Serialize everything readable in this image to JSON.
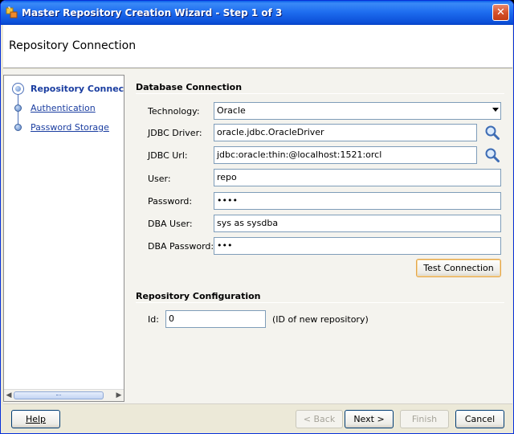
{
  "window": {
    "title": "Master Repository Creation Wizard - Step 1 of 3",
    "close_glyph": "✕"
  },
  "header": {
    "title": "Repository Connection"
  },
  "nav": {
    "items": [
      {
        "label": "Repository Connection",
        "active": true
      },
      {
        "label": "Authentication",
        "active": false
      },
      {
        "label": "Password Storage",
        "active": false
      }
    ]
  },
  "database_connection": {
    "section_title": "Database Connection",
    "technology_label": "Technology:",
    "technology_value": "Oracle",
    "jdbc_driver_label": "JDBC Driver:",
    "jdbc_driver_value": "oracle.jdbc.OracleDriver",
    "jdbc_url_label": "JDBC Url:",
    "jdbc_url_value": "jdbc:oracle:thin:@localhost:1521:orcl",
    "user_label": "User:",
    "user_value": "repo",
    "password_label": "Password:",
    "password_value": "••••",
    "dba_user_label": "DBA User:",
    "dba_user_value": "sys as sysdba",
    "dba_password_label": "DBA Password:",
    "dba_password_value": "•••",
    "test_connection_label": "Test Connection"
  },
  "repository_configuration": {
    "section_title": "Repository Configuration",
    "id_label": "Id:",
    "id_value": "0",
    "id_note": "(ID of new repository)"
  },
  "footer": {
    "help_label": "Help",
    "back_label": "< Back",
    "next_label": "Next >",
    "finish_label": "Finish",
    "cancel_label": "Cancel"
  },
  "colors": {
    "titlebar": "#0b4fd8",
    "nav_link": "#1a3da0",
    "focus_border": "#e3a54a"
  },
  "icons": {
    "app": "wizard-app-icon",
    "search": "magnifier-icon"
  }
}
